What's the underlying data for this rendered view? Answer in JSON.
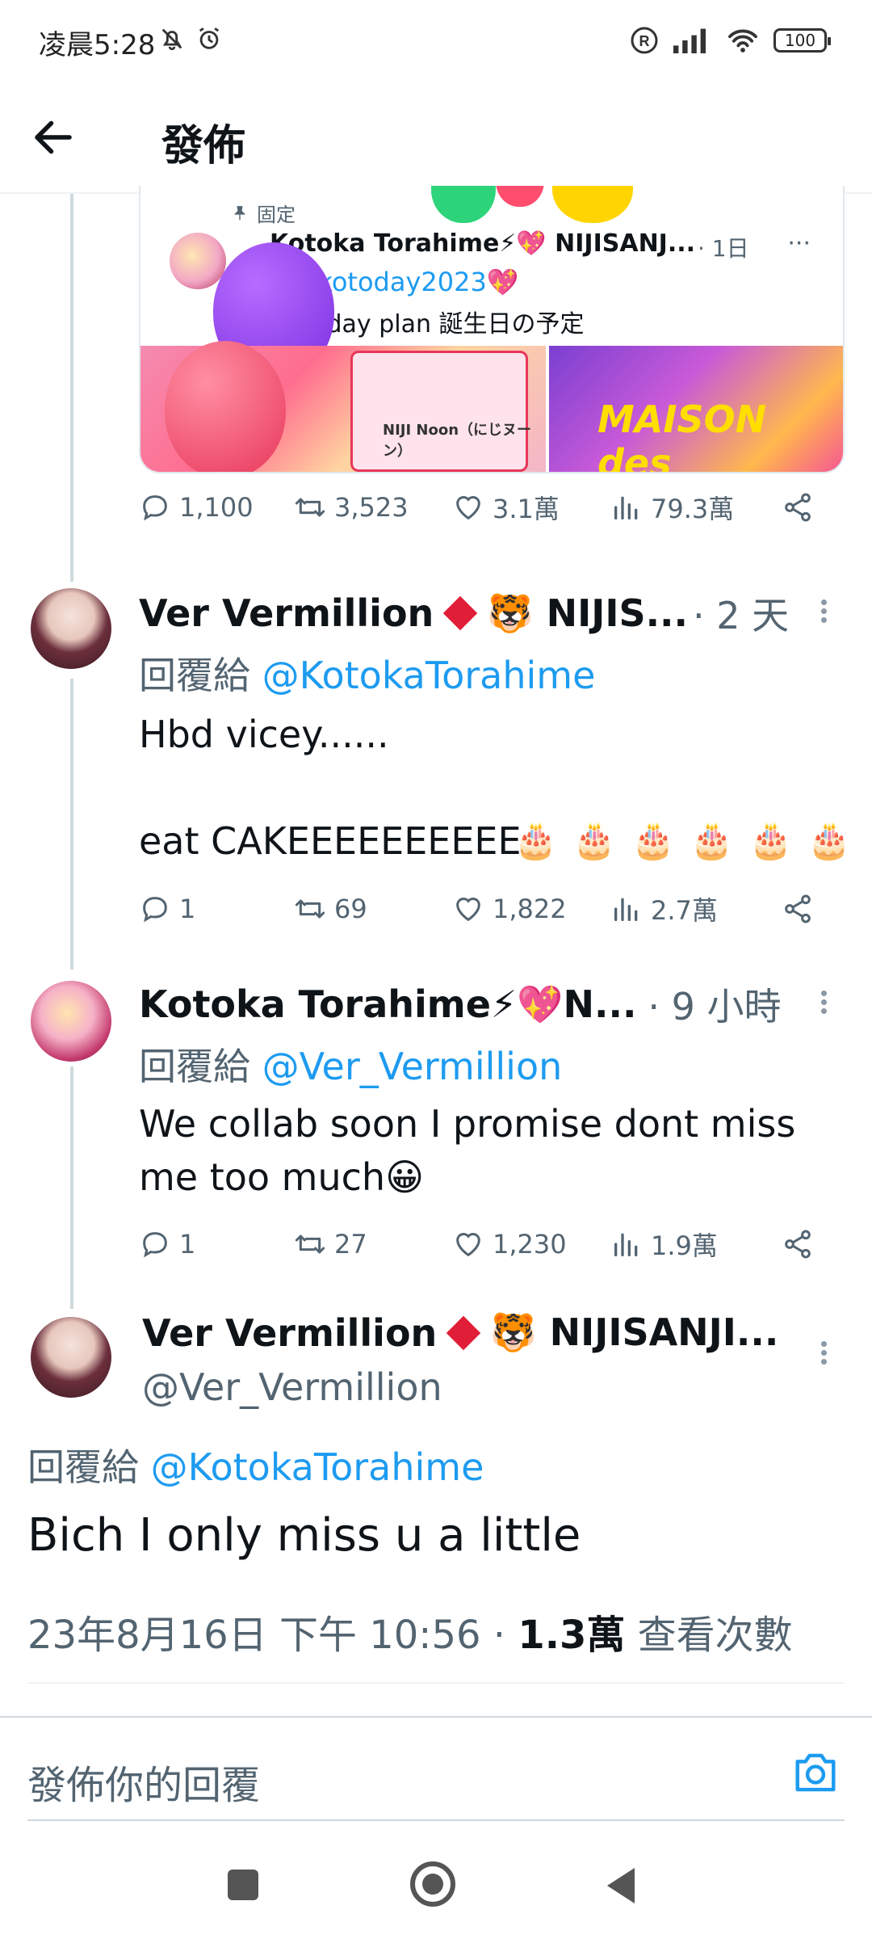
{
  "status_bar": {
    "time": "凌晨5:28",
    "battery": "100"
  },
  "header": {
    "title": "發佈"
  },
  "quoted_tweet": {
    "pinned_label": "固定",
    "author": "Kotoka Torahime⚡💖 NIJISANJ...",
    "time": "· 1日",
    "more": "···",
    "hashtag": "⚡ #kotoday2023💖",
    "text": "birthday plan 誕生日の予定",
    "image1_caption": "NIJI Noon（にじヌーン）",
    "image2_caption": "MAISON des",
    "stats": {
      "replies": "1,100",
      "retweets": "3,523",
      "likes": "3.1萬",
      "views": "79.3萬"
    }
  },
  "tweets": [
    {
      "author": "Ver Vermillion",
      "badge": "🐯 NIJIS...",
      "time": "· 2 天",
      "reply_prefix": "回覆給 ",
      "reply_to": "@KotokaTorahime",
      "text": "Hbd vicey......\n\neat CAKEEEEEEEEEE",
      "emojis": "🎂 🎂 🎂 🎂 🎂 🎂",
      "stats": {
        "replies": "1",
        "retweets": "69",
        "likes": "1,822",
        "views": "2.7萬"
      }
    },
    {
      "author": "Kotoka Torahime⚡💖N...",
      "time": "· 9 小時",
      "reply_prefix": "回覆給 ",
      "reply_to": "@Ver_Vermillion",
      "text": "We collab soon I promise dont miss me too much😀",
      "stats": {
        "replies": "1",
        "retweets": "27",
        "likes": "1,230",
        "views": "1.9萬"
      }
    }
  ],
  "main_tweet": {
    "author": "Ver Vermillion",
    "badge": "🐯 NIJISANJI...",
    "handle": "@Ver_Vermillion",
    "reply_prefix": "回覆給 ",
    "reply_to": "@KotokaTorahime",
    "text": "Bich I only miss u a little",
    "timestamp": "23年8月16日 下午 10:56 · ",
    "views_count": "1.3萬",
    "views_label": " 查看次數"
  },
  "composer": {
    "placeholder": "發佈你的回覆"
  },
  "colors": {
    "link": "#1d9bf0",
    "secondary_text": "#536471",
    "thread_line": "#cfd9de"
  }
}
